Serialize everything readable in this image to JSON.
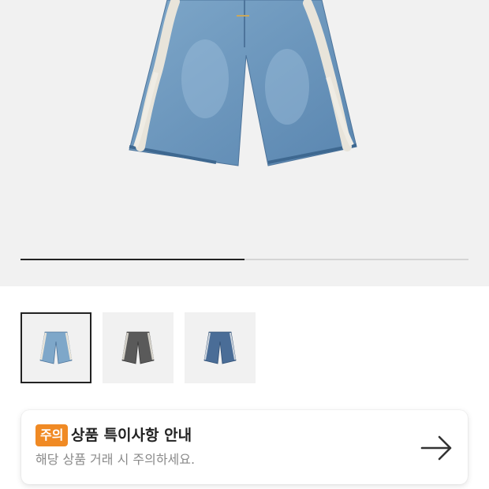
{
  "gallery": {
    "main_image": "denim-bone-shorts-light-wash",
    "progress_fraction": 0.5,
    "thumbnails": [
      {
        "name": "light-wash",
        "active": true
      },
      {
        "name": "black-wash",
        "active": false
      },
      {
        "name": "indigo-wash",
        "active": false
      }
    ]
  },
  "notice": {
    "badge": "주의",
    "title": "상품 특이사항 안내",
    "description": "해당 상품 거래 시 주의하세요.",
    "arrow_icon": "arrow-right-icon"
  },
  "colors": {
    "accent": "#f08a24",
    "hero_background": "#f1f1f1",
    "progress_fill": "#222222"
  }
}
